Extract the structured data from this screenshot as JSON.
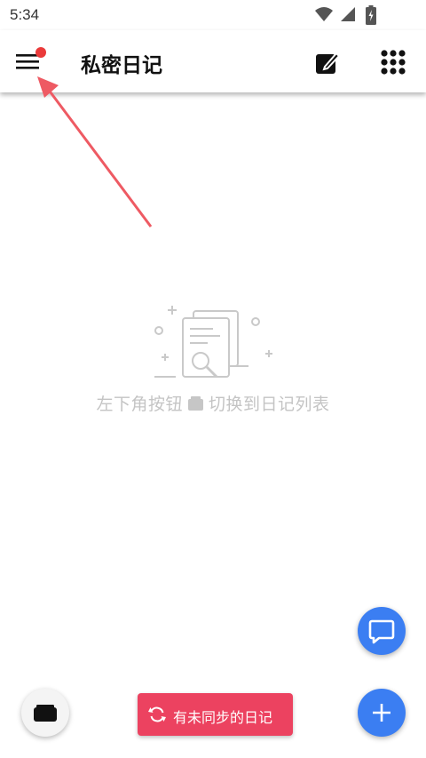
{
  "status_bar": {
    "time": "5:34",
    "icons": [
      "wifi-icon",
      "signal-icon",
      "battery-icon"
    ]
  },
  "app_bar": {
    "title": "私密日记",
    "menu_icon": "menu-icon",
    "has_notification_dot": true,
    "actions": [
      "edit-icon",
      "grid-icon"
    ]
  },
  "empty_state": {
    "illustration": "search-document-icon",
    "hint_before": "左下角按钮",
    "hint_icon": "folder-icon",
    "hint_after": "切换到日记列表"
  },
  "fabs": {
    "chat": "chat-icon",
    "add": "plus-icon",
    "list": "folder-icon"
  },
  "sync_button": {
    "label": "有未同步的日记",
    "icon": "sync-icon"
  },
  "colors": {
    "accent_blue": "#3b7ef2",
    "sync_red": "#ec4260",
    "notification_dot": "#ea3a3a",
    "hint_gray": "#c4c4c4",
    "arrow": "#ee5a63"
  }
}
